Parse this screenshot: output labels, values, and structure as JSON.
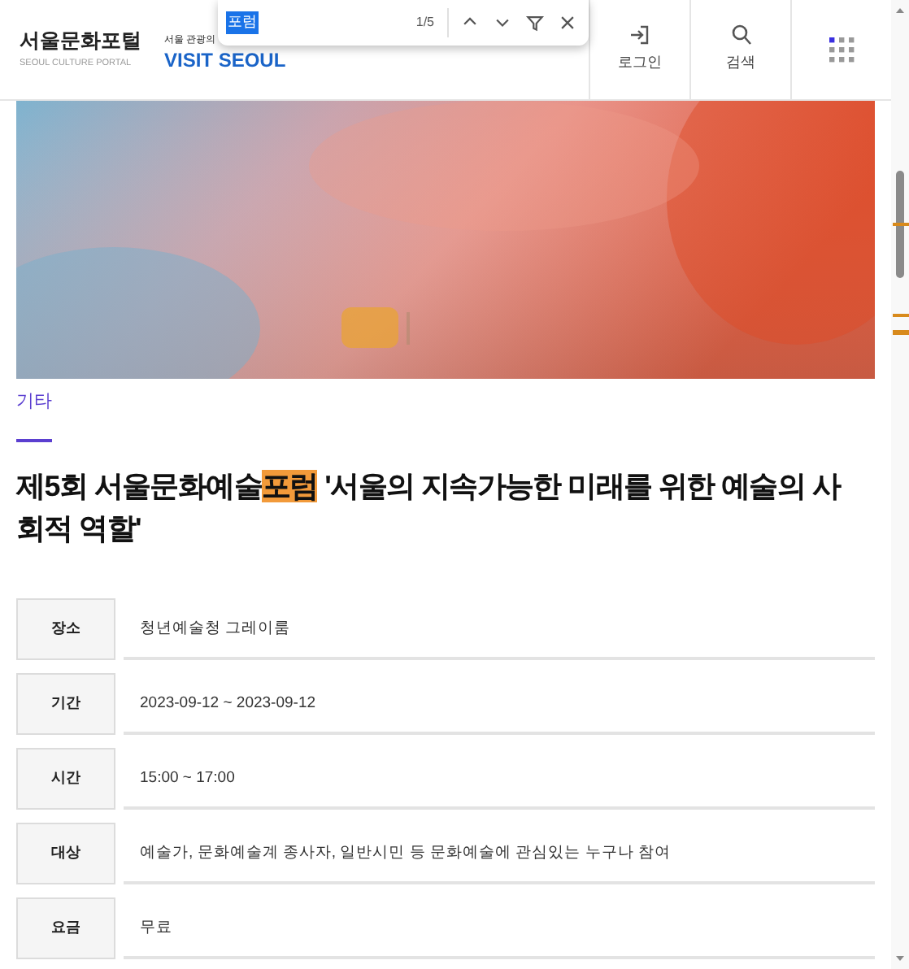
{
  "header": {
    "logo": "서울문화포털",
    "logo_sub": "SEOUL CULTURE PORTAL",
    "partner_caption": "서울 관광의",
    "partner_logo": "VISIT SEOUL",
    "buttons": [
      {
        "kind": "login",
        "label": "로그인"
      },
      {
        "kind": "search",
        "label": "검색"
      },
      {
        "kind": "menu"
      }
    ]
  },
  "find_bar": {
    "value": "포럼",
    "count": "1/5"
  },
  "category": "기타",
  "title": {
    "before": "제5회 서울문화예술",
    "match": "포럼",
    "after": " '서울의 지속가능한 미래를 위한 예술의 사회적 역할'"
  },
  "details": [
    {
      "label": "장소",
      "value": "청년예술청 그레이룸"
    },
    {
      "label": "기간",
      "value": "2023-09-12 ~ 2023-09-12"
    },
    {
      "label": "시간",
      "value": "15:00 ~ 17:00"
    },
    {
      "label": "대상",
      "value": "예술가, 문화예술계 종사자, 일반시민 등 문화예술에 관심있는 누구나 참여"
    },
    {
      "label": "요금",
      "value": "무료"
    }
  ]
}
